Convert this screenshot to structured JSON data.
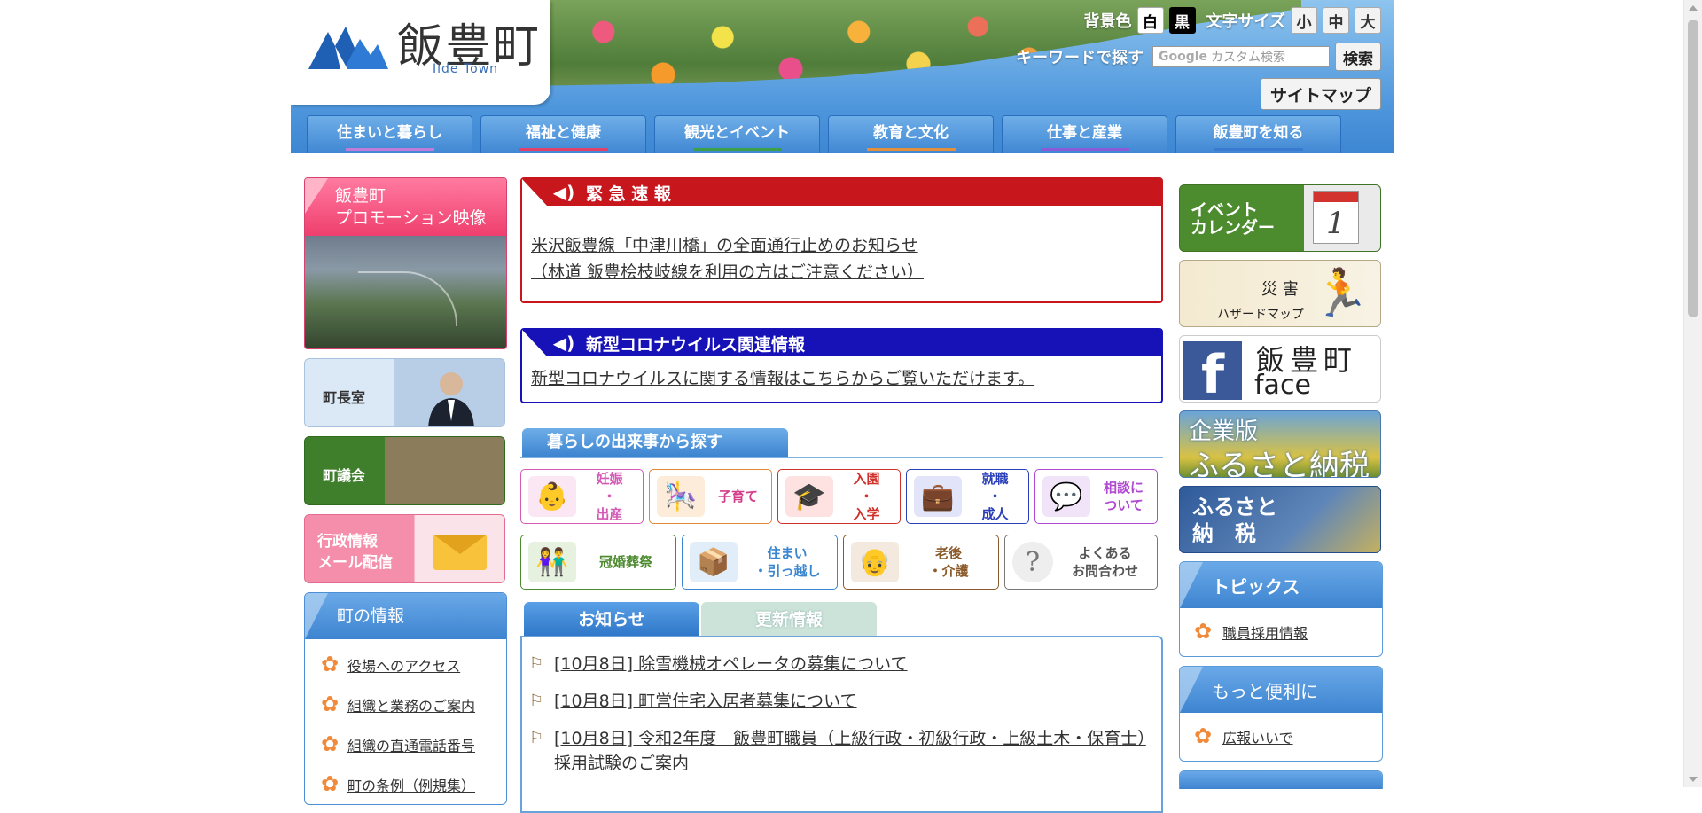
{
  "header": {
    "logo_text": "飯豊町",
    "logo_sub": "Iide Town",
    "bg_color_label": "背景色",
    "bg_white": "白",
    "bg_black": "黒",
    "font_size_label": "文字サイズ",
    "size_small": "小",
    "size_medium": "中",
    "size_large": "大",
    "keyword_label": "キーワードで探す",
    "search_brand": "Google",
    "search_placeholder": "カスタム検索",
    "search_button": "検索",
    "sitemap_button": "サイトマップ"
  },
  "gnav": [
    {
      "label": "住まいと暮らし",
      "color": "#c47ad8"
    },
    {
      "label": "福祉と健康",
      "color": "#e0406a"
    },
    {
      "label": "観光とイベント",
      "color": "#3aa04a"
    },
    {
      "label": "教育と文化",
      "color": "#e4903a"
    },
    {
      "label": "仕事と産業",
      "color": "#8a5ad8"
    },
    {
      "label": "飯豊町を知る",
      "color": "#3a7ad0"
    }
  ],
  "left": {
    "promo_line1": "飯豊町",
    "promo_line2": "プロモーション映像",
    "mayor": "町長室",
    "council": "町議会",
    "mail_line1": "行政情報",
    "mail_line2": "メール配信",
    "info_title": "町の情報",
    "info_items": [
      "役場へのアクセス",
      "組織と業務のご案内",
      "組織の直通電話番号",
      "町の条例（例規集）"
    ]
  },
  "center": {
    "alert_title": "緊 急 速 報",
    "alert_line1": "米沢飯豊線「中津川橋」の全面通行止めのお知らせ",
    "alert_line2": "（林道 飯豊桧枝岐線を利用の方はご注意ください）",
    "corona_title": "新型コロナウイルス関連情報",
    "corona_text": "新型コロナウイルスに関する情報はこちらからご覧いただけます。",
    "life_title": "暮らしの出来事から探す",
    "life_row1": [
      {
        "label1": "妊娠",
        "label2": "・",
        "label3": "出産",
        "color": "#d35ab5",
        "icon": "baby-icon",
        "glyph": "👶"
      },
      {
        "label1": "子育て",
        "label2": "",
        "label3": "",
        "color": "#e08a3a",
        "icon": "stroller-icon",
        "glyph": "🎠"
      },
      {
        "label1": "入園",
        "label2": "・",
        "label3": "入学",
        "color": "#d0302a",
        "icon": "graduation-cap-icon",
        "glyph": "🎓"
      },
      {
        "label1": "就職",
        "label2": "・",
        "label3": "成人",
        "color": "#2b3fb8",
        "icon": "briefcase-icon",
        "glyph": "💼"
      },
      {
        "label1": "相談に",
        "label2": "",
        "label3": "ついて",
        "color": "#b04ad0",
        "icon": "consultation-icon",
        "glyph": "💬"
      }
    ],
    "life_row2": [
      {
        "label1": "冠婚葬祭",
        "label2": "",
        "color": "#4c8a2e",
        "icon": "ceremony-icon",
        "glyph": "👫"
      },
      {
        "label1": "住まい",
        "label2": "・引っ越し",
        "color": "#3a86d0",
        "icon": "moving-cart-icon",
        "glyph": "📦"
      },
      {
        "label1": "老後",
        "label2": "・介護",
        "color": "#8a5a2a",
        "icon": "elderly-care-icon",
        "glyph": "👴"
      },
      {
        "label1": "よくある",
        "label2": "お問合わせ",
        "color": "#777777",
        "icon": "question-icon",
        "glyph": "?"
      }
    ],
    "tab_news": "お知らせ",
    "tab_updates": "更新情報",
    "news": [
      "[10月8日] 除雪機械オペレータの募集について",
      "[10月8日] 町営住宅入居者募集について",
      "[10月8日] 令和2年度　飯豊町職員（上級行政・初級行政・上級土木・保育士）採用試験のご案内"
    ]
  },
  "right": {
    "event_line1": "イベント",
    "event_line2": "カレンダー",
    "calendar_day": "1",
    "hazard_line1": "災 害",
    "hazard_line2": "ハザードマップ",
    "fb_line1": "飯豊町",
    "fb_line2": "face book",
    "furusato_line1": "企業版",
    "furusato_line2": "ふるさと納税",
    "tax_line1": "ふるさと",
    "tax_line2": "納　税",
    "topics_title": "トピックス",
    "topics_item": "職員採用情報",
    "convenient_title": "もっと便利に",
    "convenient_item": "広報いいで"
  }
}
